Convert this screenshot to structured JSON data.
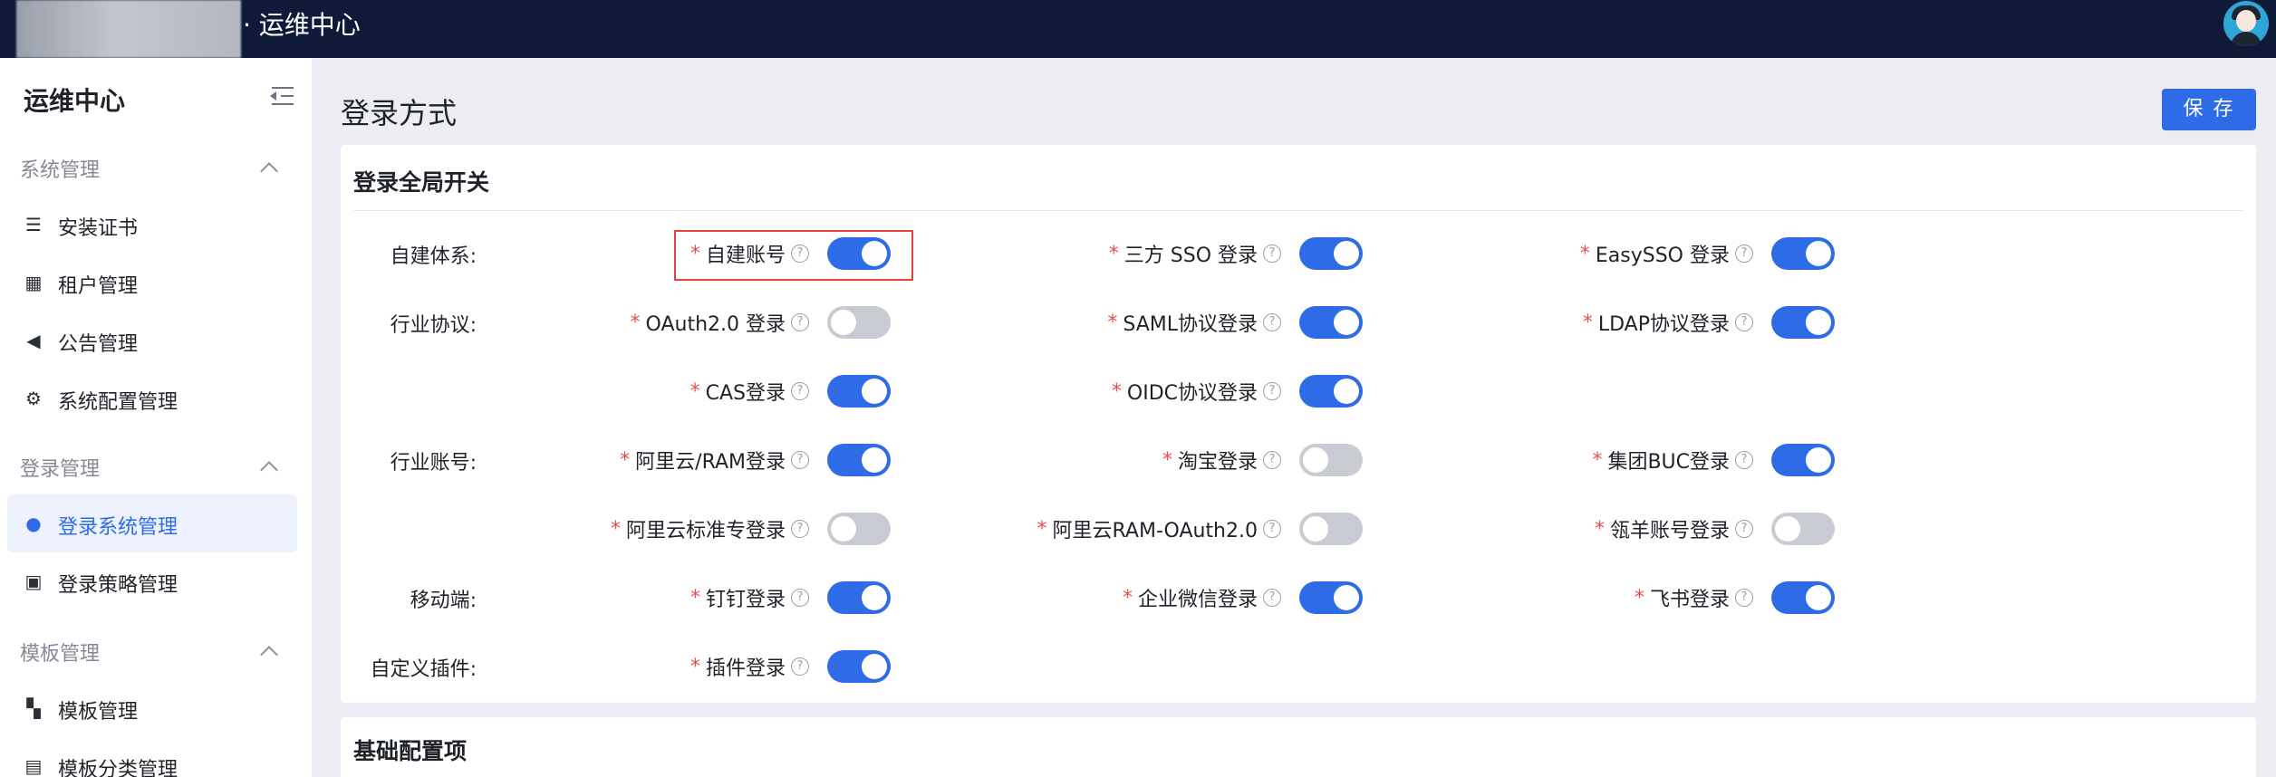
{
  "topbar": {
    "title": "· 运维中心"
  },
  "sidebar": {
    "title": "运维中心",
    "groups": [
      {
        "label": "系统管理",
        "items": [
          {
            "label": "安装证书",
            "icon": "layers-icon"
          },
          {
            "label": "租户管理",
            "icon": "building-icon"
          },
          {
            "label": "公告管理",
            "icon": "speaker-icon"
          },
          {
            "label": "系统配置管理",
            "icon": "gear-icon"
          }
        ]
      },
      {
        "label": "登录管理",
        "items": [
          {
            "label": "登录系统管理",
            "icon": "user-gear-icon",
            "active": true
          },
          {
            "label": "登录策略管理",
            "icon": "policy-icon"
          }
        ]
      },
      {
        "label": "模板管理",
        "items": [
          {
            "label": "模板管理",
            "icon": "grid-icon"
          },
          {
            "label": "模板分类管理",
            "icon": "folder-icon"
          }
        ]
      }
    ]
  },
  "main": {
    "title": "登录方式",
    "save_label": "保 存",
    "section1": {
      "title": "登录全局开关",
      "rows": [
        {
          "label": "自建体系:",
          "options": [
            {
              "label": "自建账号",
              "on": true
            },
            {
              "label": "三方 SSO 登录",
              "on": true
            },
            {
              "label": "EasySSO 登录",
              "on": true
            }
          ]
        },
        {
          "label": "行业协议:",
          "options": [
            {
              "label": "OAuth2.0 登录",
              "on": false
            },
            {
              "label": "SAML协议登录",
              "on": true
            },
            {
              "label": "LDAP协议登录",
              "on": true
            }
          ]
        },
        {
          "label": "",
          "options": [
            {
              "label": "CAS登录",
              "on": true
            },
            {
              "label": "OIDC协议登录",
              "on": true
            }
          ]
        },
        {
          "label": "行业账号:",
          "options": [
            {
              "label": "阿里云/RAM登录",
              "on": true
            },
            {
              "label": "淘宝登录",
              "on": false
            },
            {
              "label": "集团BUC登录",
              "on": true
            }
          ]
        },
        {
          "label": "",
          "options": [
            {
              "label": "阿里云标准专登录",
              "on": false
            },
            {
              "label": "阿里云RAM-OAuth2.0",
              "on": false
            },
            {
              "label": "瓴羊账号登录",
              "on": false
            }
          ]
        },
        {
          "label": "移动端:",
          "options": [
            {
              "label": "钉钉登录",
              "on": true
            },
            {
              "label": "企业微信登录",
              "on": true
            },
            {
              "label": "飞书登录",
              "on": true
            }
          ]
        },
        {
          "label": "自定义插件:",
          "options": [
            {
              "label": "插件登录",
              "on": true
            }
          ]
        }
      ]
    },
    "section2": {
      "title": "基础配置项"
    }
  },
  "colors": {
    "accent": "#2e6be6",
    "topbar": "#0f1a38",
    "highlight": "#e0453c",
    "required": "#e85050"
  }
}
